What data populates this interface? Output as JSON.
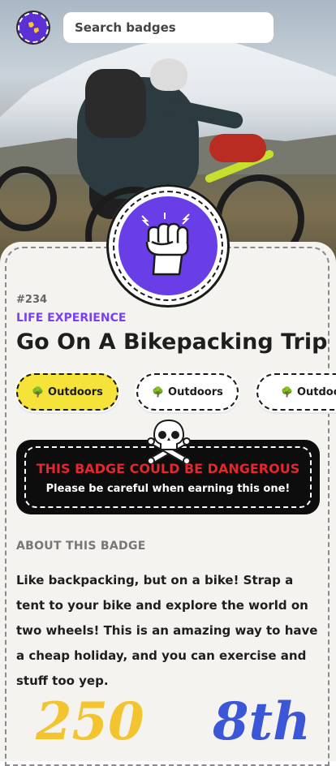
{
  "search": {
    "placeholder": "Search badges"
  },
  "badge": {
    "number": "#234",
    "category": "LIFE EXPERIENCE",
    "title": "Go On A Bikepacking Trip"
  },
  "tags": [
    {
      "label": "Outdoors",
      "icon": "tree-icon",
      "active": true
    },
    {
      "label": "Outdoors",
      "icon": "tree-icon",
      "active": false
    },
    {
      "label": "Outdoors",
      "icon": "tree-icon",
      "active": false
    }
  ],
  "warning": {
    "title": "THIS BADGE COULD BE DANGEROUS",
    "subtitle": "Please be careful when earning this one!",
    "icon": "skull-crossbones-icon"
  },
  "about": {
    "heading": "ABOUT THIS BADGE",
    "text": "Like backpacking, but on a bike! Strap a tent to your bike and explore the world on two wheels! This is an amazing way to have a cheap holiday, and you can exercise and stuff too yep."
  },
  "stats": {
    "a": "250",
    "b": "8th"
  },
  "colors": {
    "accent_purple": "#6a3ee6",
    "tag_yellow": "#f6e33a",
    "danger_red": "#e5262a"
  }
}
